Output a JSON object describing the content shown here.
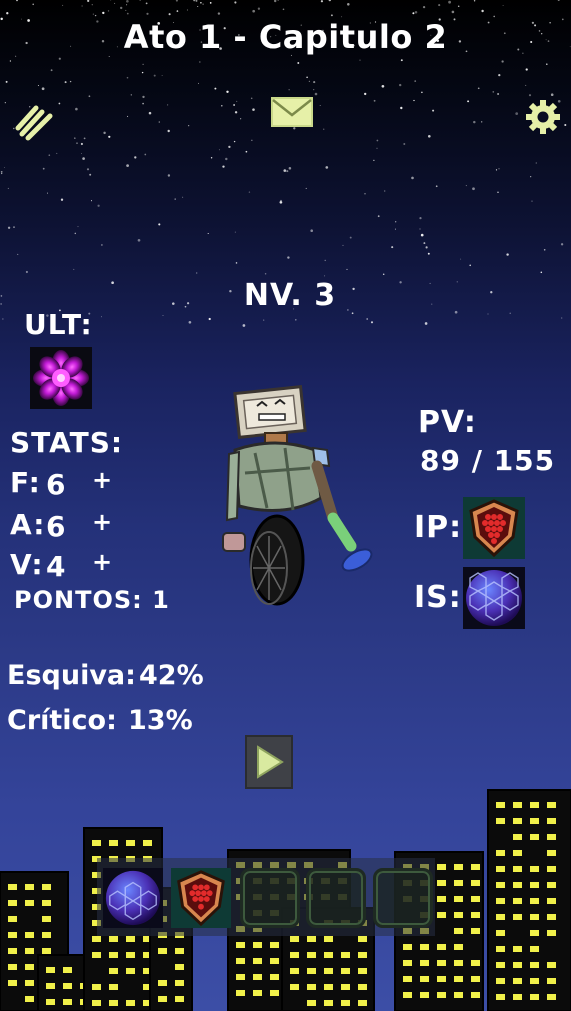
{
  "header": {
    "title": "Ato 1 - Capitulo 2"
  },
  "icons": {
    "menu": "menu-stripes-icon",
    "mail": "mail-icon",
    "settings": "gear-icon"
  },
  "colors": {
    "accent": "#e6f0a8",
    "window_light": "#f0f04a",
    "building": "#0b0b0b"
  },
  "character": {
    "level": "NV. 3",
    "ult_label": "ULT:",
    "ult_icon": "purple-flower-orb-icon",
    "stats_label": "STATS:",
    "stats": [
      {
        "key": "F:",
        "value": "6",
        "plus": "+"
      },
      {
        "key": "A:",
        "value": "6",
        "plus": "+"
      },
      {
        "key": "V:",
        "value": "4",
        "plus": "+"
      }
    ],
    "points": "PONTOS: 1",
    "pv_label": "PV:",
    "pv_value": "89 / 155",
    "ip_label": "IP:",
    "ip_icon": "shield-icon",
    "is_label": "IS:",
    "is_icon": "hex-orb-icon"
  },
  "attributes": {
    "dodge_label": "Esquiva:",
    "dodge_value": "42%",
    "crit_label": "Crítico:",
    "crit_value": "13%"
  },
  "play_icon": "play-icon",
  "inventory": [
    {
      "icon": "hex-orb-icon",
      "filled": true
    },
    {
      "icon": "shield-icon",
      "filled": true
    },
    {
      "icon": "empty-slot",
      "filled": false
    },
    {
      "icon": "empty-slot",
      "filled": false
    },
    {
      "icon": "empty-slot",
      "filled": false
    }
  ]
}
